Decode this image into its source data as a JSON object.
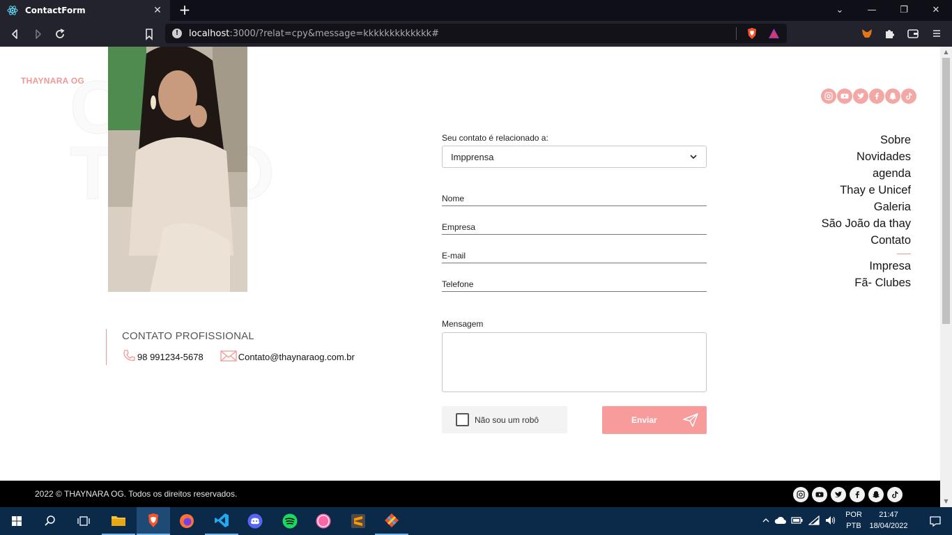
{
  "browser": {
    "tab_title": "ContactForm",
    "tab_close": "✕",
    "new_tab": "+",
    "url_host": "localhost",
    "url_rest": ":3000/?relat=cpy&message=kkkkkkkkkkkkk#",
    "window_min": "—",
    "window_restore": "❐",
    "window_close": "✕",
    "tab_dropdown": "⌄"
  },
  "page": {
    "brand": "THAYNARA OG",
    "ghost_text": "CON TATO",
    "contact": {
      "title": "CONTATO PROFISSIONAL",
      "phone": "98 991234-5678",
      "email": "Contato@thaynaraog.com.br"
    },
    "form": {
      "select_label": "Seu contato é relacionado a:",
      "select_value": "Impprensa",
      "name_placeholder": "Nome",
      "company_placeholder": "Empresa",
      "email_placeholder": "E-mail",
      "phone_placeholder": "Telefone",
      "message_label": "Mensagem",
      "captcha_label": "Não sou um robô",
      "send_label": "Enviar"
    },
    "socials": [
      "instagram-icon",
      "youtube-icon",
      "twitter-icon",
      "facebook-icon",
      "snapchat-icon",
      "tiktok-icon"
    ],
    "menu": {
      "items": [
        "Sobre",
        "Novidades",
        "agenda",
        "Thay e Unicef",
        "Galeria",
        "São João da thay",
        "Contato"
      ],
      "sub_items": [
        "Impresa",
        "Fã- Clubes"
      ]
    },
    "footer": {
      "copyright": "2022 © THAYNARA OG. Todos os direitos reservados."
    }
  },
  "taskbar": {
    "lang_line1": "POR",
    "lang_line2": "PTB",
    "time": "21:47",
    "date": "18/04/2022"
  },
  "colors": {
    "accent": "#f29797",
    "button": "#f79c9b",
    "footer_bg": "#000000",
    "taskbar_bg": "#0b2a4a"
  }
}
